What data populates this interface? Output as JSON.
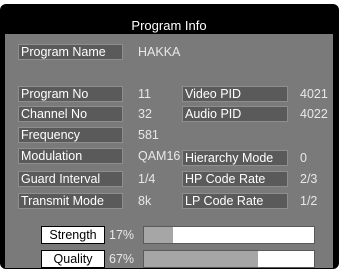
{
  "title": "Program Info",
  "program_name": {
    "label": "Program Name",
    "value": "HAKKA"
  },
  "left_rows": [
    {
      "label": "Program No",
      "value": "11"
    },
    {
      "label": "Channel No",
      "value": "32"
    },
    {
      "label": "Frequency",
      "value": "581"
    },
    {
      "label": "Modulation",
      "value": "QAM16"
    },
    {
      "label": "Guard Interval",
      "value": "1/4"
    },
    {
      "label": "Transmit Mode",
      "value": "8k"
    }
  ],
  "right_rows": [
    {
      "label": "Video PID",
      "value": "4021"
    },
    {
      "label": "Audio PID",
      "value": "4022"
    },
    {
      "label": "Hierarchy Mode",
      "value": "0"
    },
    {
      "label": "HP Code Rate",
      "value": "2/3"
    },
    {
      "label": "LP Code Rate",
      "value": "1/2"
    }
  ],
  "signal": {
    "strength": {
      "label": "Strength",
      "value": "17%",
      "level": 0.17
    },
    "quality": {
      "label": "Quality",
      "value": "67%",
      "level": 0.67
    }
  }
}
